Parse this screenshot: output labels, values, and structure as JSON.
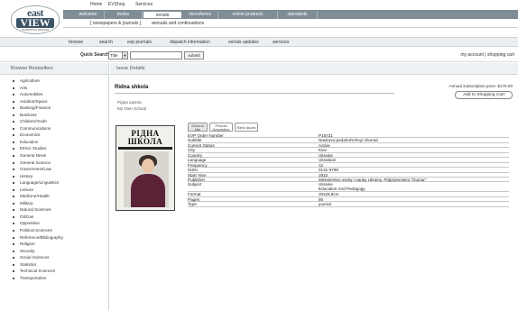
{
  "logo": {
    "line1": "east",
    "line2": "VIEW",
    "line3": "INFORMATION SERVICES"
  },
  "home_links": [
    "Home",
    "EVShop",
    "Services"
  ],
  "main_nav": [
    {
      "label": "welcome",
      "active": false
    },
    {
      "label": "books",
      "active": false
    },
    {
      "label": "serials",
      "active": true
    },
    {
      "label": "microforms",
      "active": false
    },
    {
      "label": "online products",
      "active": false
    },
    {
      "label": "standards",
      "active": false
    }
  ],
  "sub_nav1": [
    "[ newspapers & journals ]",
    "annuals and continuations"
  ],
  "sub_nav2": [
    "browse",
    "search",
    "evp journals",
    "dispatch information",
    "serials updates",
    "services"
  ],
  "quick_search": {
    "label": "Quick Search",
    "select_value": "Title",
    "input_value": "",
    "button_label": "submit"
  },
  "account_links": "my account  |  shopping cart",
  "left": {
    "header": "Browse Bestsellers",
    "items": [
      "Agriculture",
      "Arts",
      "Automobiles",
      "Aviation/Space",
      "Banking/Finance",
      "Business",
      "Children/Youth",
      "Communications",
      "Economics",
      "Education",
      "Ethnic Studies",
      "General News",
      "General Science",
      "Government/Law",
      "History",
      "Language/Linguistics",
      "Leisure",
      "Medicine/Health",
      "Military",
      "Natural Sciences",
      "Oil/Gas",
      "Opposition",
      "Political Sciences",
      "Reference/Bibliography",
      "Religion",
      "Security",
      "Social Sciences",
      "Statistics",
      "Technical Sciences",
      "Transportation"
    ]
  },
  "right": {
    "header": "Issue Details",
    "title": "Ridna shkola",
    "price": "Annual subscription price: $170.00",
    "cart_button": "Add to Shopping Cart",
    "alt_titles": [
      "Рідна школа",
      "My Own School"
    ],
    "cover": {
      "title_line1": "РІДНА",
      "title_line2": "ШКОЛА"
    },
    "tabs": [
      {
        "label": "General Info",
        "active": true
      },
      {
        "label": "Product Description",
        "active": false
      },
      {
        "label": "Rank Issues",
        "active": false
      }
    ],
    "details": [
      {
        "k": "EVP Order Number",
        "v": "P16721"
      },
      {
        "k": "Subtitle",
        "v": "Naukovo-pedahohichnyi zhurnal"
      },
      {
        "k": "Current Status",
        "v": "Active"
      },
      {
        "k": "City",
        "v": "Kiev"
      },
      {
        "k": "Country",
        "v": "Ukraine"
      },
      {
        "k": "Language",
        "v": "Ukrainian"
      },
      {
        "k": "Frequency",
        "v": "12"
      },
      {
        "k": "ISSN",
        "v": "0131-6788"
      },
      {
        "k": "Start Year",
        "v": "1922"
      },
      {
        "k": "Publisher",
        "v": "Ministerstvo osvity i nauky Ukrainy. Pidpryiemstvo \"Dumar\""
      },
      {
        "k": "Subject",
        "v": "Ukraine",
        "v2": "Education And Pedagogy"
      },
      {
        "k": "Format",
        "v": "20x28,8cm"
      },
      {
        "k": "Pages",
        "v": "80"
      },
      {
        "k": "Type",
        "v": "journal"
      }
    ]
  }
}
